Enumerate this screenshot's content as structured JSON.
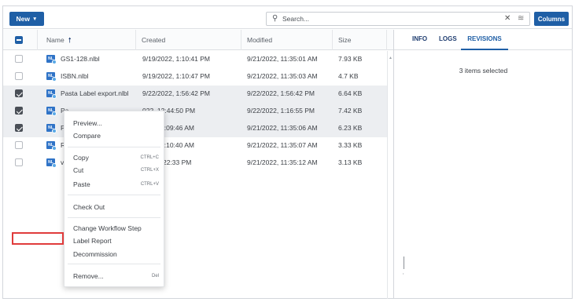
{
  "toolbar": {
    "new_label": "New",
    "search_placeholder": "Search...",
    "columns_label": "Columns"
  },
  "grid": {
    "headers": {
      "name": "Name",
      "created": "Created",
      "modified": "Modified",
      "size": "Size"
    },
    "rows": [
      {
        "name": "GS1-128.nlbl",
        "created": "9/19/2022, 1:10:41 PM",
        "modified": "9/21/2022, 11:35:01 AM",
        "size": "7.93 KB",
        "checked": false
      },
      {
        "name": "ISBN.nlbl",
        "created": "9/19/2022, 1:10:47 PM",
        "modified": "9/21/2022, 11:35:03 AM",
        "size": "4.7 KB",
        "checked": false
      },
      {
        "name": "Pasta Label export.nlbl",
        "created": "9/22/2022, 1:56:42 PM",
        "modified": "9/22/2022, 1:56:42 PM",
        "size": "6.64 KB",
        "checked": true
      },
      {
        "name": "Pa",
        "created": "022, 12:44:50 PM",
        "modified": "9/22/2022, 1:16:55 PM",
        "size": "7.42 KB",
        "checked": true
      },
      {
        "name": "Pa",
        "created": "022, 11:09:46 AM",
        "modified": "9/21/2022, 11:35:06 AM",
        "size": "6.23 KB",
        "checked": true
      },
      {
        "name": "RT",
        "created": "022, 11:10:40 AM",
        "modified": "9/21/2022, 11:35:07 AM",
        "size": "3.33 KB",
        "checked": false
      },
      {
        "name": "va",
        "created": "022, 1:22:33 PM",
        "modified": "9/21/2022, 11:35:12 AM",
        "size": "3.13 KB",
        "checked": false
      }
    ]
  },
  "panel": {
    "tabs": {
      "info": "INFO",
      "logs": "LOGS",
      "revisions": "REVISIONS"
    },
    "selection_text": "3 items selected"
  },
  "context_menu": {
    "preview": "Preview...",
    "compare": "Compare",
    "copy": "Copy",
    "copy_shortcut": "CTRL+C",
    "cut": "Cut",
    "cut_shortcut": "CTRL+X",
    "paste": "Paste",
    "paste_shortcut": "CTRL+V",
    "check_out": "Check Out",
    "change_workflow": "Change Workflow Step",
    "label_report": "Label Report",
    "decommission": "Decommission",
    "remove": "Remove...",
    "remove_shortcut": "Del"
  },
  "icon_names": [
    "search-icon",
    "clear-icon",
    "filter-icon",
    "sort-asc-icon",
    "file-label-icon"
  ],
  "colors": {
    "accent": "#1f5fa6",
    "highlight_border": "#e03b3b"
  }
}
